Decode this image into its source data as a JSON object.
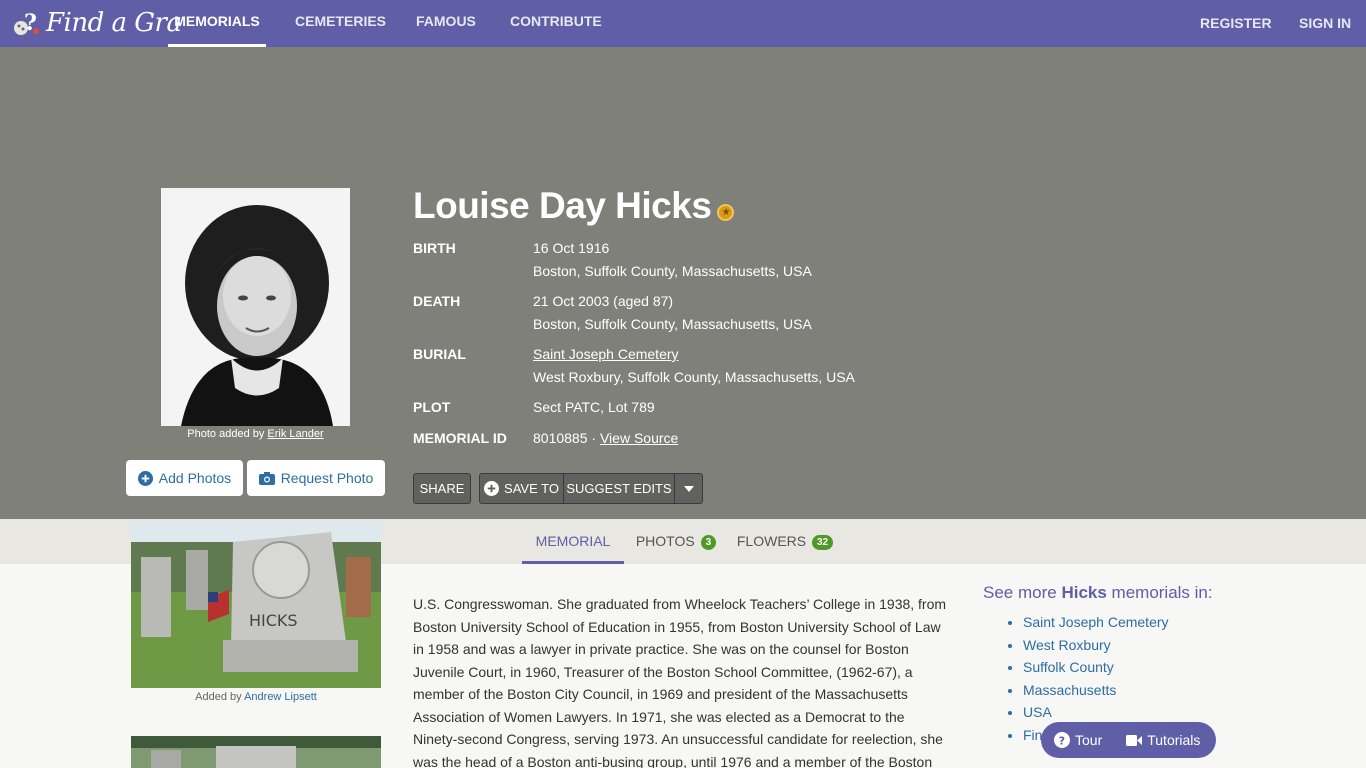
{
  "nav": {
    "logo_text": "Find a Gra",
    "links": [
      "MEMORIALS",
      "CEMETERIES",
      "FAMOUS",
      "CONTRIBUTE"
    ],
    "register": "REGISTER",
    "sign_in": "SIGN IN"
  },
  "memorial": {
    "name": "Louise Day Hicks",
    "famous_icon": "star-badge-icon",
    "birth_label": "BIRTH",
    "birth_date": "16 Oct 1916",
    "birth_place": "Boston, Suffolk County, Massachusetts, USA",
    "death_label": "DEATH",
    "death_date": "21 Oct 2003 (aged 87)",
    "death_place": "Boston, Suffolk County, Massachusetts, USA",
    "burial_label": "BURIAL",
    "burial_cemetery": "Saint Joseph Cemetery",
    "burial_place": "West Roxbury, Suffolk County, Massachusetts, USA",
    "plot_label": "PLOT",
    "plot": "Sect PATC, Lot 789",
    "memorial_id_label": "MEMORIAL ID",
    "memorial_id": "8010885",
    "id_separator": " · ",
    "view_source": "View Source"
  },
  "photo": {
    "caption_prefix": "Photo added by ",
    "added_by": "Erik Lander",
    "add_photos": "Add Photos",
    "request_photo": "Request Photo"
  },
  "actions": {
    "share": "SHARE",
    "save_to": "SAVE TO",
    "suggest_edits": "SUGGEST EDITS"
  },
  "tabs": {
    "memorial": "MEMORIAL",
    "photos": "PHOTOS",
    "photos_count": "3",
    "flowers": "FLOWERS",
    "flowers_count": "32"
  },
  "gallery": {
    "caption_prefix": "Added by ",
    "added_by": "Andrew Lipsett",
    "stone_text": "HICKS"
  },
  "bio": "U.S. Congresswoman. She graduated from Wheelock Teachers’ College in 1938, from Boston University School of Education in 1955, from Boston University School of Law in 1958 and was a lawyer in private practice. She was on the counsel for Boston Juvenile Court, in 1960, Treasurer of the Boston School Committee, (1962-67), a member of the Boston City Council, in 1969 and president of the Massachusetts Association of Women Lawyers. In 1971, she was elected as a Democrat to the Ninety-second Congress, serving 1973. An unsuccessful candidate for reelection, she was the head of a Boston anti-busing group, until 1976 and a member of the Boston City",
  "see_more": {
    "prefix": "See more ",
    "surname": "Hicks",
    "suffix": " memorials in:",
    "items": [
      "Saint Joseph Cemetery",
      "West Roxbury",
      "Suffolk County",
      "Massachusetts",
      "USA",
      "Fin"
    ]
  },
  "help": {
    "tour": "Tour",
    "tutorials": "Tutorials"
  },
  "colors": {
    "brand": "#5f5ea7",
    "hero": "#80807b",
    "link": "#2d6da3",
    "count_badge": "#4f9a27"
  }
}
